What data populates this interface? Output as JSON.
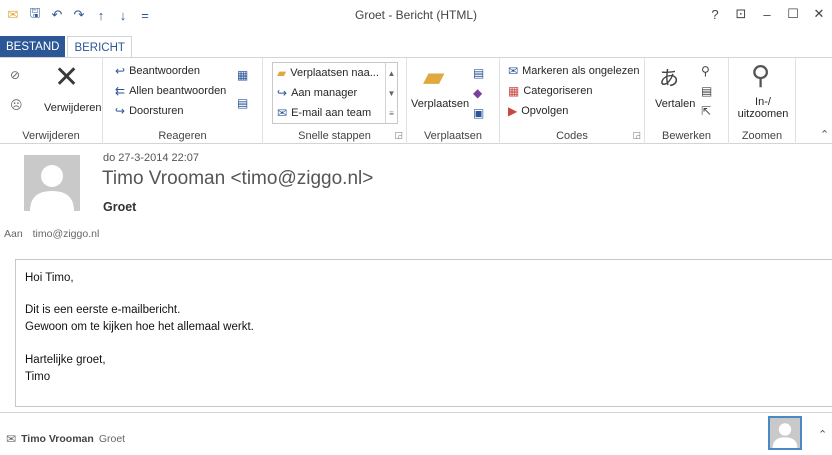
{
  "window": {
    "title": "Groet - Bericht (HTML)",
    "help": "?",
    "ribbon_display": "⊡",
    "minimize": "–",
    "maximize": "☐",
    "close": "✕"
  },
  "qat": {
    "mail": "✉",
    "save": "🖫",
    "undo": "↶",
    "redo": "↷",
    "up": "↑",
    "down": "↓",
    "customize": "="
  },
  "tabs": {
    "file": "BESTAND",
    "message": "BERICHT"
  },
  "ribbon": {
    "verwijderen": {
      "label": "Verwijderen",
      "group": "Verwijderen"
    },
    "reageren": {
      "group": "Reageren",
      "reply": "Beantwoorden",
      "reply_all": "Allen beantwoorden",
      "forward": "Doorsturen"
    },
    "snelle_stappen": {
      "group": "Snelle stappen",
      "items": [
        "Verplaatsen naa...",
        "Aan manager",
        "E-mail aan team"
      ]
    },
    "verplaatsen": {
      "group": "Verplaatsen",
      "label": "Verplaatsen"
    },
    "codes": {
      "group": "Codes",
      "unread": "Markeren als ongelezen",
      "categorize": "Categoriseren",
      "followup": "Opvolgen"
    },
    "bewerken": {
      "group": "Bewerken",
      "translate": "Vertalen"
    },
    "zoomen": {
      "group": "Zoomen",
      "zoom_line1": "In-/",
      "zoom_line2": "uitzoomen"
    }
  },
  "message": {
    "date": "do 27-3-2014 22:07",
    "sender": "Timo Vrooman <timo@ziggo.nl>",
    "subject": "Groet",
    "to_label": "Aan",
    "to_value": "timo@ziggo.nl",
    "body": [
      "Hoi Timo,",
      "Dit is een eerste e-mailbericht.",
      "Gewoon om te kijken hoe het allemaal werkt.",
      "Hartelijke groet,",
      "Timo"
    ]
  },
  "footer": {
    "name": "Timo Vrooman",
    "subject": "Groet"
  },
  "colors": {
    "accent": "#2b5797",
    "avatar_border": "#4a89c8"
  }
}
